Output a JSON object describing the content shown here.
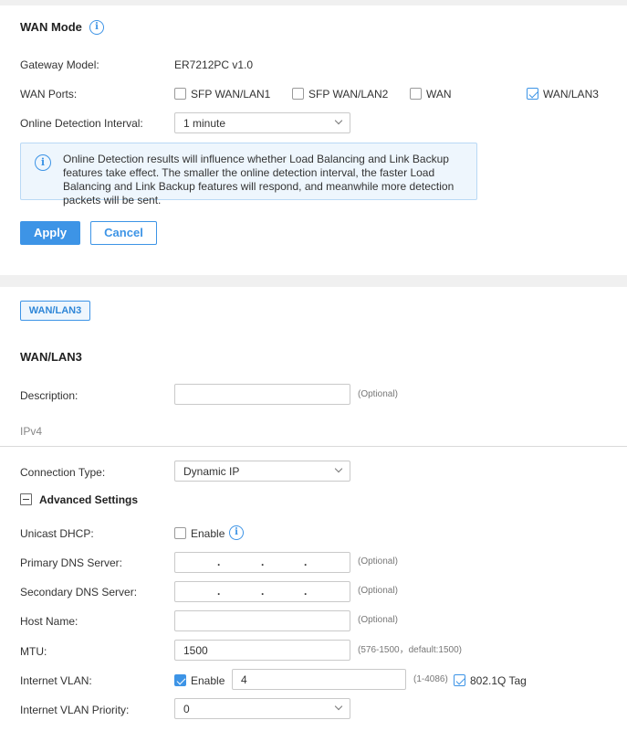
{
  "wan_mode": {
    "title": "WAN Mode",
    "gateway_model_label": "Gateway Model:",
    "gateway_model_value": "ER7212PC v1.0",
    "wan_ports_label": "WAN Ports:",
    "ports": [
      {
        "label": "SFP WAN/LAN1",
        "checked": false
      },
      {
        "label": "SFP WAN/LAN2",
        "checked": false
      },
      {
        "label": "WAN",
        "checked": false
      },
      {
        "label": "WAN/LAN3",
        "checked": true
      }
    ],
    "online_detection_label": "Online Detection Interval:",
    "online_detection_value": "1 minute",
    "info_text": "Online Detection results will influence whether Load Balancing and Link Backup features take effect. The smaller the online detection interval, the faster Load Balancing and Link Backup features will respond, and meanwhile more detection packets will be sent.",
    "apply_label": "Apply",
    "cancel_label": "Cancel"
  },
  "wan_port": {
    "tab_label": "WAN/LAN3",
    "title": "WAN/LAN3",
    "description_label": "Description:",
    "description_value": "",
    "optional_hint": "(Optional)",
    "ipv4_label": "IPv4",
    "connection_type_label": "Connection Type:",
    "connection_type_value": "Dynamic IP",
    "advanced_settings_label": "Advanced Settings",
    "unicast_dhcp_label": "Unicast DHCP:",
    "unicast_enable_label": "Enable",
    "primary_dns_label": "Primary DNS Server:",
    "secondary_dns_label": "Secondary DNS Server:",
    "host_name_label": "Host Name:",
    "mtu_label": "MTU:",
    "mtu_value": "1500",
    "mtu_hint": "(576-1500，default:1500)",
    "internet_vlan_label": "Internet VLAN:",
    "vlan_enable_label": "Enable",
    "vlan_value": "4",
    "vlan_hint": "(1-4086)",
    "tag_label": "802.1Q Tag",
    "vlan_priority_label": "Internet VLAN Priority:",
    "vlan_priority_value": "0"
  },
  "colors": {
    "accent": "#3d94e6",
    "info_bg": "#eef6fd"
  }
}
